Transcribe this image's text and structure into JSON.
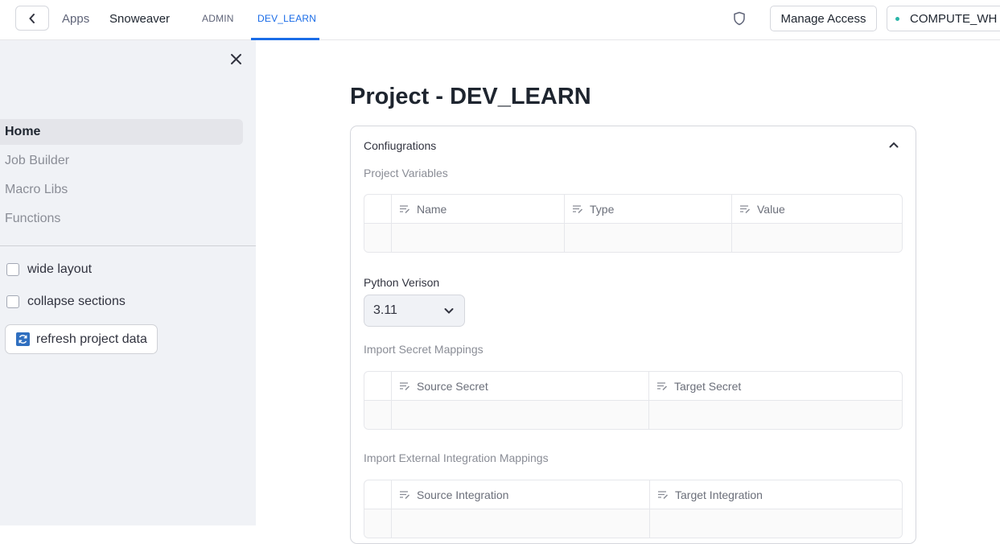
{
  "header": {
    "breadcrumb_apps": "Apps",
    "app_name": "Snoweaver",
    "tabs": [
      {
        "label": "ADMIN",
        "active": false
      },
      {
        "label": "DEV_LEARN",
        "active": true
      }
    ],
    "manage_access_label": "Manage Access",
    "warehouse_label": "COMPUTE_WH",
    "accent_color": "#1a6ce7",
    "warehouse_status_color": "#29b5a8"
  },
  "sidebar": {
    "nav_items": [
      {
        "label": "Home",
        "active": true
      },
      {
        "label": "Job Builder",
        "active": false
      },
      {
        "label": "Macro Libs",
        "active": false
      },
      {
        "label": "Functions",
        "active": false
      }
    ],
    "options": [
      {
        "label": "wide layout",
        "checked": false
      },
      {
        "label": "collapse sections",
        "checked": false
      }
    ],
    "refresh_label": "refresh project data"
  },
  "main": {
    "title": "Project - DEV_LEARN",
    "panel_title": "Confiugrations",
    "project_variables": {
      "label": "Project Variables",
      "columns": [
        "Name",
        "Type",
        "Value"
      ]
    },
    "python_version": {
      "label": "Python Verison",
      "value": "3.11"
    },
    "secret_mappings": {
      "label": "Import Secret Mappings",
      "columns": [
        "Source Secret",
        "Target Secret"
      ]
    },
    "integration_mappings": {
      "label": "Import External Integration Mappings",
      "columns": [
        "Source Integration",
        "Target Integration"
      ]
    }
  }
}
